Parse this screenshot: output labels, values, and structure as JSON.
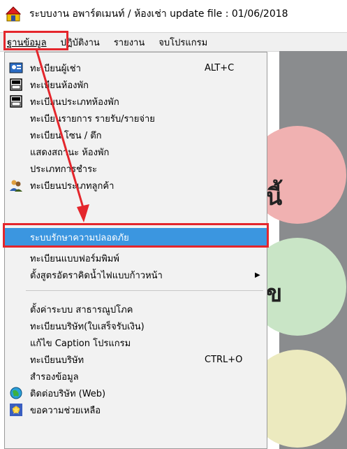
{
  "window": {
    "title": "ระบบงาน อพาร์ตเมนท์ / ห้องเช่า update file : 01/06/2018",
    "icon": "house-icon"
  },
  "menubar": {
    "items": [
      {
        "label": "ฐานข้อมูล"
      },
      {
        "label": "ปฏิบัติงาน"
      },
      {
        "label": "รายงาน"
      },
      {
        "label": "จบโปรแกรม"
      }
    ]
  },
  "dropdown": {
    "items": [
      {
        "label": "ทะเบียนผู้เช่า",
        "shortcut": "ALT+C",
        "icon": "tenant-register-icon"
      },
      {
        "label": "ทะเบียนห้องพัก",
        "icon": "room-register-icon"
      },
      {
        "label": "ทะเบียนประเภทห้องพัก",
        "icon": "room-type-icon"
      },
      {
        "label": "ทะเบียนรายการ รายรับ/รายจ่าย"
      },
      {
        "label": "ทะเบียน โซน / ตึก"
      },
      {
        "label": "แสดงสถานะ ห้องพัก"
      },
      {
        "label": "ประเภทการชำระ"
      },
      {
        "label": "ทะเบียนประเภทลูกค้า",
        "icon": "customer-type-icon"
      },
      {
        "label": "ระบบรักษาความปลอดภัย"
      },
      {
        "label": "ทะเบียนแบบฟอร์มพิมพ์"
      },
      {
        "label": "ตั้งสูตรอัตราคิดน้ำไฟแบบก้าวหน้า",
        "arrow": "▶"
      },
      {
        "label": "ตั้งค่าระบบ สาธารณูปโภค"
      },
      {
        "label": "ทะเบียนบริษัท(ใบเสร็จรับเงิน)"
      },
      {
        "label": "แก้ไข Caption โปรแกรม"
      },
      {
        "label": "ทะเบียนบริษัท",
        "shortcut": "CTRL+O"
      },
      {
        "label": "สำรองข้อมูล"
      },
      {
        "label": "ติดต่อบริษัท (Web)",
        "icon": "web-contact-icon"
      },
      {
        "label": "ขอความช่วยเหลือ",
        "icon": "help-icon"
      }
    ]
  },
  "background": {
    "big_text_1": "นี้",
    "big_text_2": "ข"
  },
  "colors": {
    "highlight_box": "#e4262c",
    "selected_row": "#3b96e0"
  }
}
